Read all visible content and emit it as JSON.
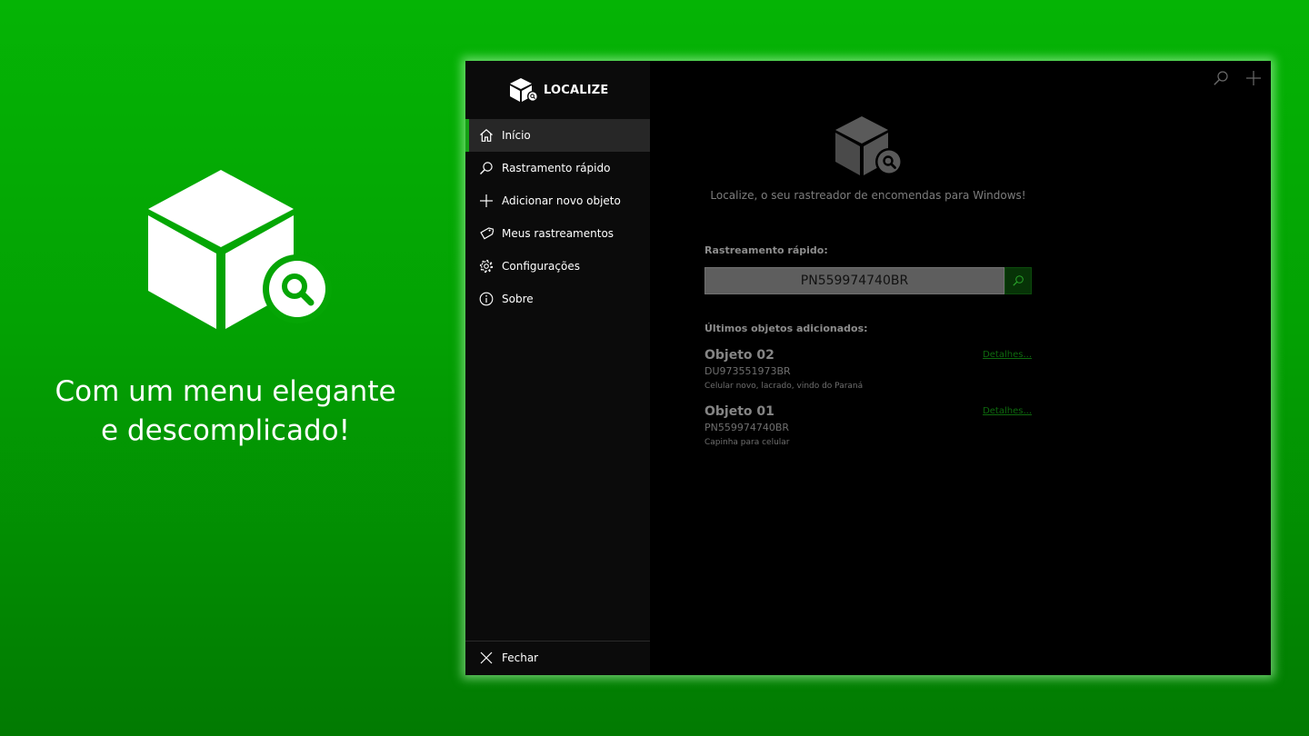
{
  "promo": {
    "caption_line1": "Com um menu elegante",
    "caption_line2": "e descomplicado!"
  },
  "app": {
    "title": "LOCALIZE",
    "nav": [
      {
        "label": "Início",
        "icon": "home-icon",
        "active": true
      },
      {
        "label": "Rastramento rápido",
        "icon": "search-icon"
      },
      {
        "label": "Adicionar novo objeto",
        "icon": "plus-icon"
      },
      {
        "label": "Meus rastreamentos",
        "icon": "tag-icon"
      },
      {
        "label": "Configurações",
        "icon": "gear-icon"
      },
      {
        "label": "Sobre",
        "icon": "info-icon"
      }
    ],
    "footer_item": {
      "label": "Fechar",
      "icon": "close-icon"
    }
  },
  "main": {
    "tagline": "Localize, o seu rastreador de encomendas para Windows!",
    "quick_track_label": "Rastreamento rápido:",
    "quick_track_value": "PN559974740BR",
    "recent_label": "Últimos objetos adicionados:",
    "objects": [
      {
        "name": "Objeto 02",
        "code": "DU973551973BR",
        "description": "Celular novo, lacrado, vindo do Paraná",
        "link": "Detalhes..."
      },
      {
        "name": "Objeto 01",
        "code": "PN559974740BR",
        "description": "Capinha para celular",
        "link": "Detalhes..."
      }
    ]
  },
  "colors": {
    "accent": "#16a016",
    "background_green": "#03a103",
    "window_bg": "#000000",
    "sidebar_bg": "#0b0b0b"
  }
}
